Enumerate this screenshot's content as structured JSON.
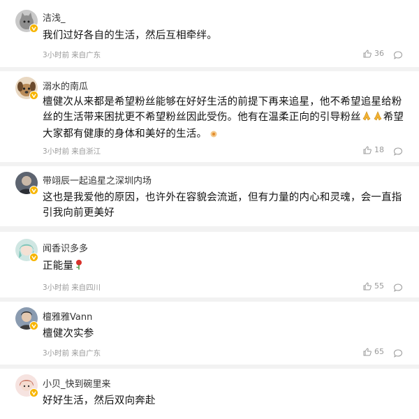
{
  "colors": {
    "badge": "#f7b500",
    "meta_text": "#9a9a9a",
    "separator": "#f2f2f2"
  },
  "comments": [
    {
      "username": "洁浅_",
      "content": "我们过好各自的生活，然后互相牵绊。",
      "time": "3小时前",
      "location": "来自广东",
      "likes": "36",
      "avatar_icon": "gray-cat-avatar"
    },
    {
      "username": "溺水的南瓜",
      "content": "檀健次从来都是希望粉丝能够在好好生活的前提下再来追星，他不希望追星给粉丝的生活带来困扰更不希望粉丝因此受伤。他有在温柔正向的引导粉丝",
      "content_tail": "希望大家都有健康的身体和美好的生活。",
      "time": "3小时前",
      "location": "来自浙江",
      "likes": "18",
      "avatar_icon": "dog-avatar",
      "emojis": [
        "praying-hands-icon",
        "praying-hands-icon",
        "sparkle-emoji-icon"
      ]
    },
    {
      "username": "带翊辰一起追星之深圳内场",
      "content": "这也是我爱他的原因，也许外在容貌会流逝，但有力量的内心和灵魂，会一直指引我向前更美好",
      "avatar_icon": "dark-portrait-avatar"
    },
    {
      "username": "闻香识多多",
      "content": "正能量",
      "time": "3小时前",
      "location": "来自四川",
      "likes": "55",
      "avatar_icon": "anime-girl-avatar",
      "emojis": [
        "rose-icon"
      ]
    },
    {
      "username": "檀雅雅Vann",
      "content": "檀健次实参",
      "time": "3小时前",
      "location": "来自广东",
      "likes": "65",
      "avatar_icon": "man-portrait-avatar"
    },
    {
      "username": "小贝_快到碗里来",
      "content": "好好生活，然后双向奔赴",
      "avatar_icon": "pink-girl-avatar"
    }
  ]
}
